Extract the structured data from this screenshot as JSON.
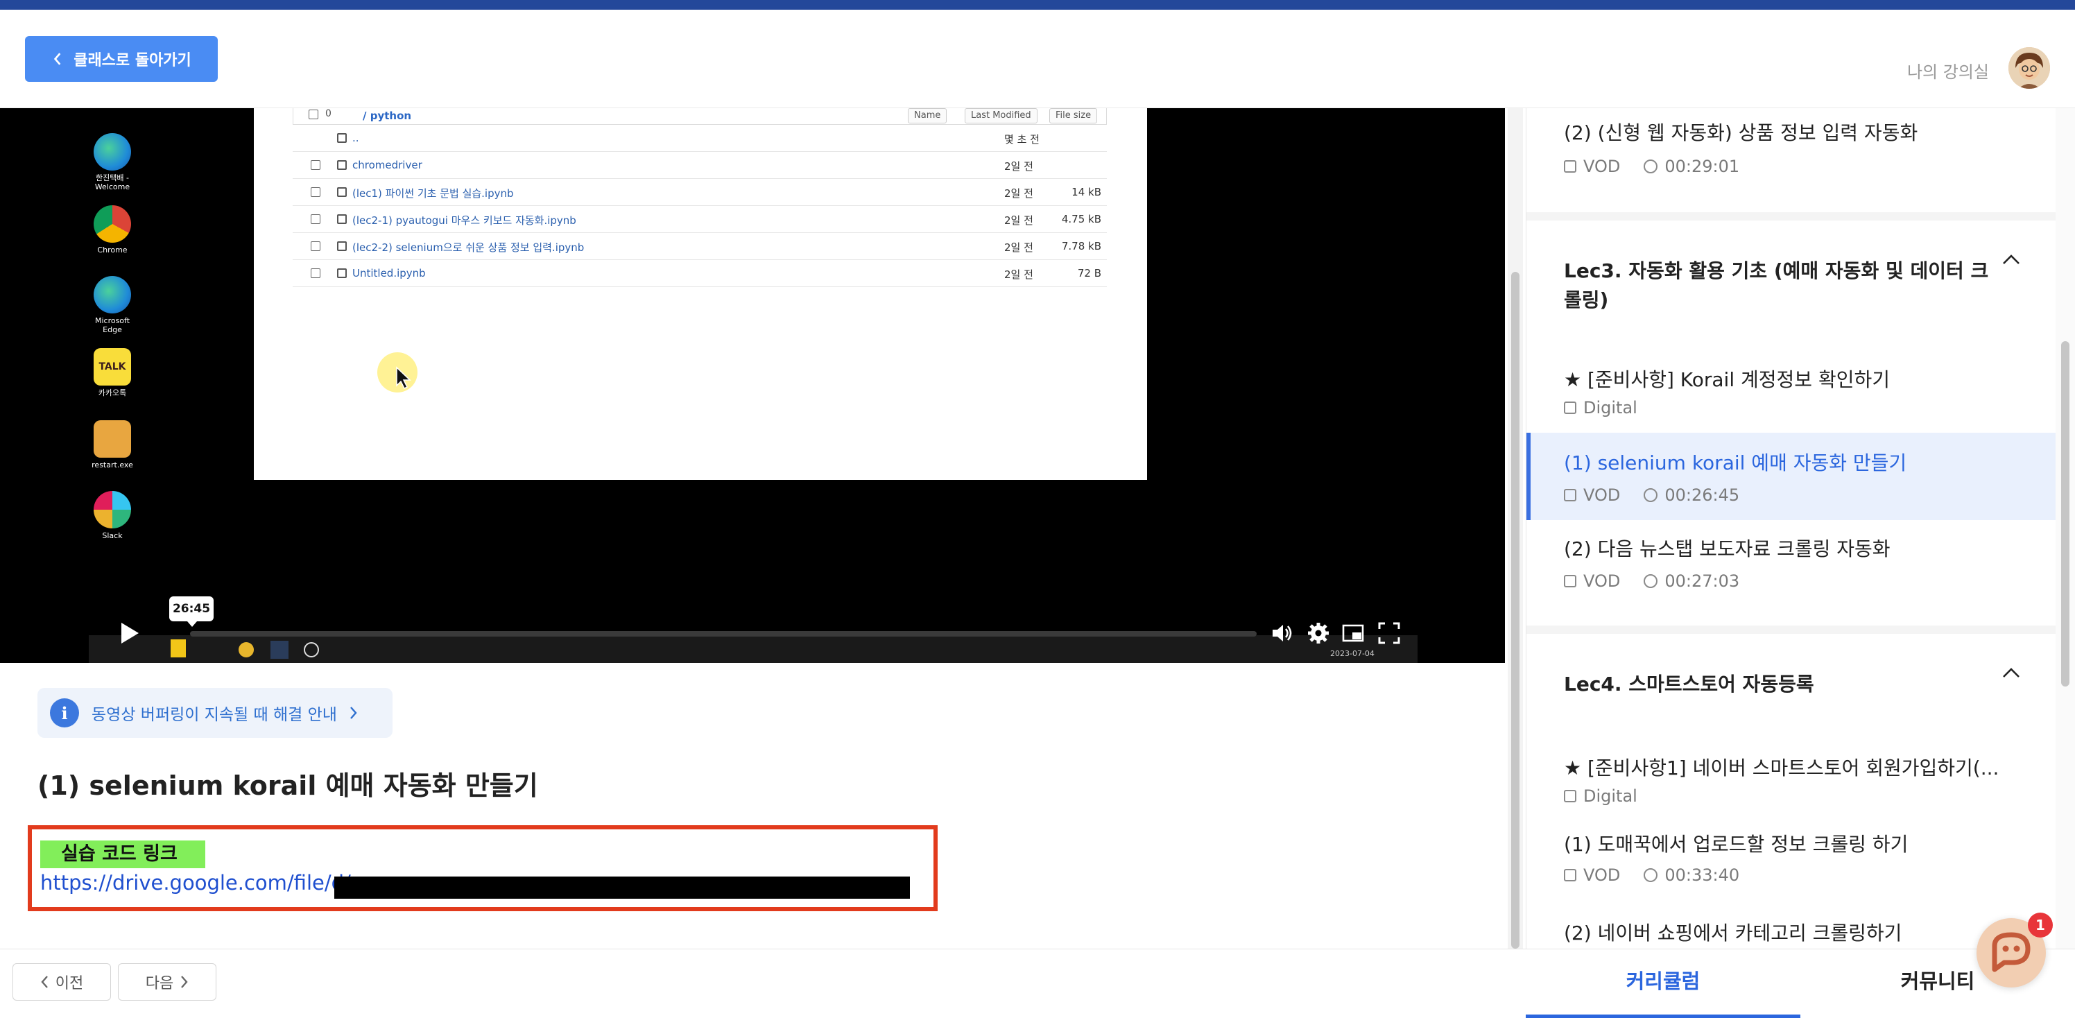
{
  "header": {
    "back_label": "클래스로 돌아가기",
    "my_room_label": "나의 강의실"
  },
  "video": {
    "desktop_icons": [
      {
        "label": "한진택배 - Welcome",
        "color": "#1f8bd8"
      },
      {
        "label": "Chrome",
        "color": "#e8b62c"
      },
      {
        "label": "Microsoft Edge",
        "color": "#1f8bd8"
      },
      {
        "label": "카카오톡",
        "color": "#f9dd3a"
      },
      {
        "label": "restart.exe",
        "color": "#e8a640"
      },
      {
        "label": "Slack",
        "color": "#e8e8e8"
      }
    ],
    "jupyter": {
      "count": "0",
      "path": "/ python",
      "col_name": "Name",
      "col_modified": "Last Modified",
      "col_size": "File size",
      "rows": [
        {
          "name": "..",
          "time": "몇 초 전",
          "size": ""
        },
        {
          "name": "chromedriver",
          "time": "2일 전",
          "size": ""
        },
        {
          "name": "(lec1) 파이썬 기초 문법 실습.ipynb",
          "time": "2일 전",
          "size": "14 kB"
        },
        {
          "name": "(lec2-1) pyautogui 마우스 키보드 자동화.ipynb",
          "time": "2일 전",
          "size": "4.75 kB"
        },
        {
          "name": "(lec2-2) selenium으로 쉬운 상품 정보 입력.ipynb",
          "time": "2일 전",
          "size": "7.78 kB"
        },
        {
          "name": "Untitled.ipynb",
          "time": "2일 전",
          "size": "72 B"
        }
      ]
    },
    "time_tooltip": "26:45",
    "taskbar_date": "2023-07-04",
    "progress_fraction": 0.0
  },
  "notice": {
    "label": "동영상 버퍼링이 지속될 때 해결 안내",
    "icon_char": "i"
  },
  "lesson": {
    "title": "(1) selenium korail 예매 자동화 만들기",
    "link_label": "실습 코드 링크",
    "link_url": "https://drive.google.com/file/d/"
  },
  "nav": {
    "prev": "이전",
    "next": "다음"
  },
  "sidebar": {
    "items": [
      {
        "title": "(2) (신형 웹 자동화) 상품 정보 입력 자동화",
        "type": "VOD",
        "duration": "00:29:01"
      }
    ],
    "sections": [
      {
        "title": "Lec3. 자동화 활용 기초 (예매 자동화 및 데이터 크롤링)",
        "items": [
          {
            "title": "★ [준비사항] Korail 계정정보 확인하기",
            "type": "Digital",
            "duration": ""
          },
          {
            "title": "(1) selenium korail 예매 자동화 만들기",
            "type": "VOD",
            "duration": "00:26:45"
          },
          {
            "title": "(2) 다음 뉴스탭 보도자료 크롤링 자동화",
            "type": "VOD",
            "duration": "00:27:03"
          }
        ]
      },
      {
        "title": "Lec4. 스마트스토어 자동등록",
        "items": [
          {
            "title": "★ [준비사항1] 네이버 스마트스토어 회원가입하기(...",
            "type": "Digital",
            "duration": ""
          },
          {
            "title": "(1) 도매꾹에서 업로드할 정보 크롤링 하기",
            "type": "VOD",
            "duration": "00:33:40"
          },
          {
            "title": "(2) 네이버 쇼핑에서 카테고리 크롤링하기",
            "type": "",
            "duration": ""
          }
        ]
      }
    ]
  },
  "tabs": {
    "curriculum": "커리큘럼",
    "community": "커뮤니티"
  },
  "chat": {
    "badge": "1"
  },
  "colors": {
    "accent": "#2b66de",
    "button": "#4a8cf3",
    "highlight_box": "#e23b1d",
    "link_label_bg": "#82ee5a"
  }
}
